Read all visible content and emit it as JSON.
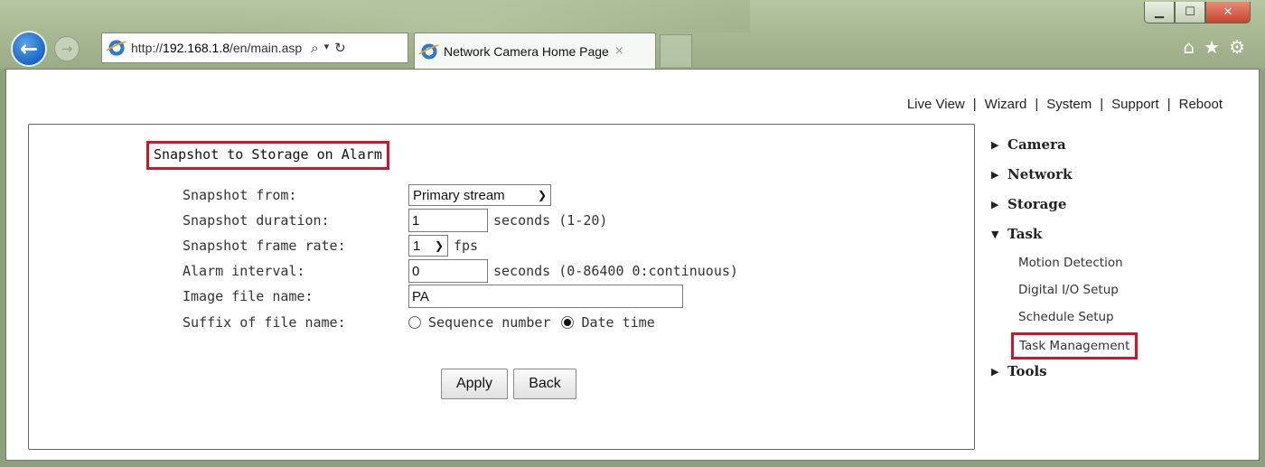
{
  "browser": {
    "url_prefix": "http://",
    "url_host": "192.168.1.8",
    "url_path": "/en/main.asp",
    "tab_title": "Network Camera Home Page",
    "tab_close": "×"
  },
  "topnav": {
    "links": [
      "Live View",
      "Wizard",
      "System",
      "Support",
      "Reboot"
    ],
    "separator": "|"
  },
  "form": {
    "title": "Snapshot to Storage on Alarm",
    "snapshot_from": {
      "label": "Snapshot from:",
      "value": "Primary stream"
    },
    "snapshot_duration": {
      "label": "Snapshot duration:",
      "value": "1",
      "hint": "seconds (1-20)"
    },
    "snapshot_frame_rate": {
      "label": "Snapshot frame rate:",
      "value": "1",
      "hint": "fps"
    },
    "alarm_interval": {
      "label": "Alarm interval:",
      "value": "0",
      "hint": "seconds (0-86400 0:continuous)"
    },
    "image_file_name": {
      "label": "Image file name:",
      "value": "PA"
    },
    "suffix": {
      "label": "Suffix of file name:",
      "options": [
        "Sequence number",
        "Date time"
      ],
      "selected": "Date time"
    },
    "apply_label": "Apply",
    "back_label": "Back"
  },
  "menu": {
    "camera": "Camera",
    "network": "Network",
    "storage": "Storage",
    "task": "Task",
    "task_items": [
      "Motion Detection",
      "Digital I/O Setup",
      "Schedule Setup",
      "Task Management"
    ],
    "tools": "Tools"
  },
  "colors": {
    "highlight_red": "#d0152a",
    "ie_blue": "#1a66c4"
  },
  "icons": {
    "back": "back-arrow-icon",
    "forward": "forward-arrow-icon",
    "ie": "internet-explorer-icon",
    "search": "search-icon",
    "refresh": "refresh-icon",
    "home": "home-icon",
    "favorites": "star-icon",
    "tools": "gear-icon"
  }
}
